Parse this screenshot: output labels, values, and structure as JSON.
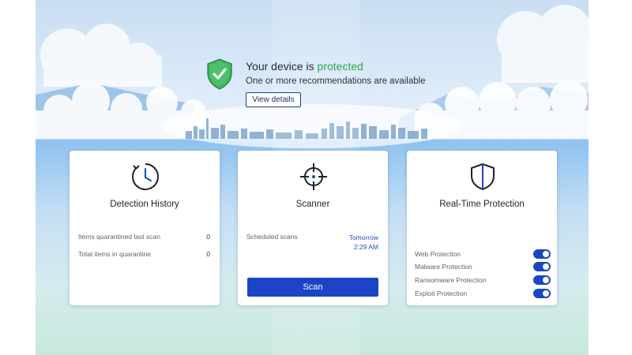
{
  "hero": {
    "title_prefix": "Your device is ",
    "title_status": "protected",
    "subtitle": "One or more recommendations are available",
    "details_button": "View details"
  },
  "cards": {
    "detection": {
      "title": "Detection History",
      "rows": [
        {
          "label": "Items quarantined last scan",
          "value": "0"
        },
        {
          "label": "Total items in quarantine",
          "value": "0"
        }
      ]
    },
    "scanner": {
      "title": "Scanner",
      "scheduled_label": "Scheduled scans",
      "scheduled_day": "Tomorrow",
      "scheduled_time": "2:29 AM",
      "scan_button": "Scan"
    },
    "realtime": {
      "title": "Real-Time Protection",
      "toggles": [
        {
          "label": "Web Protection",
          "on": true
        },
        {
          "label": "Malware Protection",
          "on": true
        },
        {
          "label": "Ransomware Protection",
          "on": true
        },
        {
          "label": "Exploit Protection",
          "on": true
        }
      ]
    }
  },
  "icons": {
    "status": "shield-check-icon",
    "detection": "clock-icon",
    "scanner": "crosshair-icon",
    "realtime": "shield-icon"
  },
  "colors": {
    "protected_green": "#2fa84f",
    "accent_blue": "#1b45c6",
    "link_blue": "#1f4fb8"
  }
}
